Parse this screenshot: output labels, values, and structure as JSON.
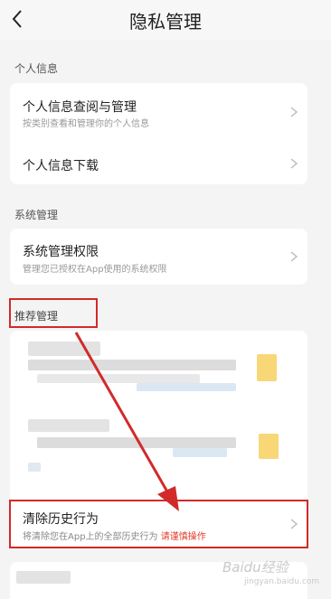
{
  "header": {
    "title": "隐私管理",
    "back_icon": "back-chevron-icon"
  },
  "sections": {
    "personal": {
      "label": "个人信息",
      "items": [
        {
          "title": "个人信息查阅与管理",
          "subtitle": "按类别查看和管理你的个人信息"
        },
        {
          "title": "个人信息下载"
        }
      ]
    },
    "system": {
      "label": "系统管理",
      "items": [
        {
          "title": "系统管理权限",
          "subtitle": "管理您已授权在App使用的系统权限"
        }
      ]
    },
    "recommend": {
      "label": "推荐管理",
      "clear_history": {
        "title": "清除历史行为",
        "subtitle": "将清除您在App上的全部历史行为",
        "warning": "请谨慎操作"
      }
    }
  },
  "watermark": {
    "text": "Baidu经验",
    "sub": "jingyan.baidu.com"
  },
  "colors": {
    "highlight": "#d22a2a",
    "warning": "#e53a2a",
    "blur_yellow": "#f8d777"
  }
}
